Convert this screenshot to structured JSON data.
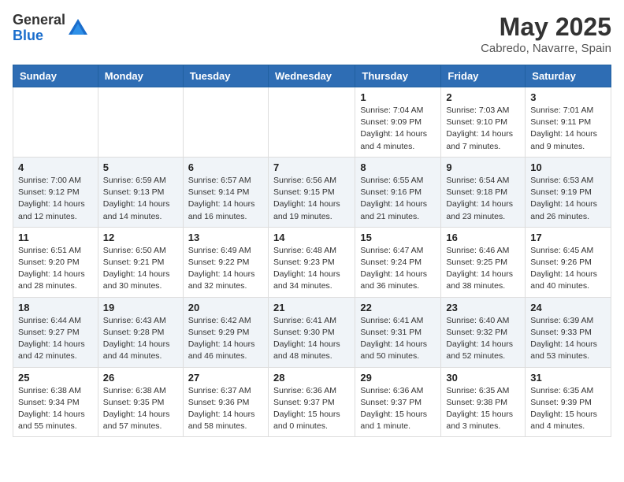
{
  "logo": {
    "general": "General",
    "blue": "Blue"
  },
  "title": "May 2025",
  "location": "Cabredo, Navarre, Spain",
  "days_of_week": [
    "Sunday",
    "Monday",
    "Tuesday",
    "Wednesday",
    "Thursday",
    "Friday",
    "Saturday"
  ],
  "weeks": [
    [
      {
        "day": "",
        "detail": ""
      },
      {
        "day": "",
        "detail": ""
      },
      {
        "day": "",
        "detail": ""
      },
      {
        "day": "",
        "detail": ""
      },
      {
        "day": "1",
        "detail": "Sunrise: 7:04 AM\nSunset: 9:09 PM\nDaylight: 14 hours\nand 4 minutes."
      },
      {
        "day": "2",
        "detail": "Sunrise: 7:03 AM\nSunset: 9:10 PM\nDaylight: 14 hours\nand 7 minutes."
      },
      {
        "day": "3",
        "detail": "Sunrise: 7:01 AM\nSunset: 9:11 PM\nDaylight: 14 hours\nand 9 minutes."
      }
    ],
    [
      {
        "day": "4",
        "detail": "Sunrise: 7:00 AM\nSunset: 9:12 PM\nDaylight: 14 hours\nand 12 minutes."
      },
      {
        "day": "5",
        "detail": "Sunrise: 6:59 AM\nSunset: 9:13 PM\nDaylight: 14 hours\nand 14 minutes."
      },
      {
        "day": "6",
        "detail": "Sunrise: 6:57 AM\nSunset: 9:14 PM\nDaylight: 14 hours\nand 16 minutes."
      },
      {
        "day": "7",
        "detail": "Sunrise: 6:56 AM\nSunset: 9:15 PM\nDaylight: 14 hours\nand 19 minutes."
      },
      {
        "day": "8",
        "detail": "Sunrise: 6:55 AM\nSunset: 9:16 PM\nDaylight: 14 hours\nand 21 minutes."
      },
      {
        "day": "9",
        "detail": "Sunrise: 6:54 AM\nSunset: 9:18 PM\nDaylight: 14 hours\nand 23 minutes."
      },
      {
        "day": "10",
        "detail": "Sunrise: 6:53 AM\nSunset: 9:19 PM\nDaylight: 14 hours\nand 26 minutes."
      }
    ],
    [
      {
        "day": "11",
        "detail": "Sunrise: 6:51 AM\nSunset: 9:20 PM\nDaylight: 14 hours\nand 28 minutes."
      },
      {
        "day": "12",
        "detail": "Sunrise: 6:50 AM\nSunset: 9:21 PM\nDaylight: 14 hours\nand 30 minutes."
      },
      {
        "day": "13",
        "detail": "Sunrise: 6:49 AM\nSunset: 9:22 PM\nDaylight: 14 hours\nand 32 minutes."
      },
      {
        "day": "14",
        "detail": "Sunrise: 6:48 AM\nSunset: 9:23 PM\nDaylight: 14 hours\nand 34 minutes."
      },
      {
        "day": "15",
        "detail": "Sunrise: 6:47 AM\nSunset: 9:24 PM\nDaylight: 14 hours\nand 36 minutes."
      },
      {
        "day": "16",
        "detail": "Sunrise: 6:46 AM\nSunset: 9:25 PM\nDaylight: 14 hours\nand 38 minutes."
      },
      {
        "day": "17",
        "detail": "Sunrise: 6:45 AM\nSunset: 9:26 PM\nDaylight: 14 hours\nand 40 minutes."
      }
    ],
    [
      {
        "day": "18",
        "detail": "Sunrise: 6:44 AM\nSunset: 9:27 PM\nDaylight: 14 hours\nand 42 minutes."
      },
      {
        "day": "19",
        "detail": "Sunrise: 6:43 AM\nSunset: 9:28 PM\nDaylight: 14 hours\nand 44 minutes."
      },
      {
        "day": "20",
        "detail": "Sunrise: 6:42 AM\nSunset: 9:29 PM\nDaylight: 14 hours\nand 46 minutes."
      },
      {
        "day": "21",
        "detail": "Sunrise: 6:41 AM\nSunset: 9:30 PM\nDaylight: 14 hours\nand 48 minutes."
      },
      {
        "day": "22",
        "detail": "Sunrise: 6:41 AM\nSunset: 9:31 PM\nDaylight: 14 hours\nand 50 minutes."
      },
      {
        "day": "23",
        "detail": "Sunrise: 6:40 AM\nSunset: 9:32 PM\nDaylight: 14 hours\nand 52 minutes."
      },
      {
        "day": "24",
        "detail": "Sunrise: 6:39 AM\nSunset: 9:33 PM\nDaylight: 14 hours\nand 53 minutes."
      }
    ],
    [
      {
        "day": "25",
        "detail": "Sunrise: 6:38 AM\nSunset: 9:34 PM\nDaylight: 14 hours\nand 55 minutes."
      },
      {
        "day": "26",
        "detail": "Sunrise: 6:38 AM\nSunset: 9:35 PM\nDaylight: 14 hours\nand 57 minutes."
      },
      {
        "day": "27",
        "detail": "Sunrise: 6:37 AM\nSunset: 9:36 PM\nDaylight: 14 hours\nand 58 minutes."
      },
      {
        "day": "28",
        "detail": "Sunrise: 6:36 AM\nSunset: 9:37 PM\nDaylight: 15 hours\nand 0 minutes."
      },
      {
        "day": "29",
        "detail": "Sunrise: 6:36 AM\nSunset: 9:37 PM\nDaylight: 15 hours\nand 1 minute."
      },
      {
        "day": "30",
        "detail": "Sunrise: 6:35 AM\nSunset: 9:38 PM\nDaylight: 15 hours\nand 3 minutes."
      },
      {
        "day": "31",
        "detail": "Sunrise: 6:35 AM\nSunset: 9:39 PM\nDaylight: 15 hours\nand 4 minutes."
      }
    ]
  ]
}
